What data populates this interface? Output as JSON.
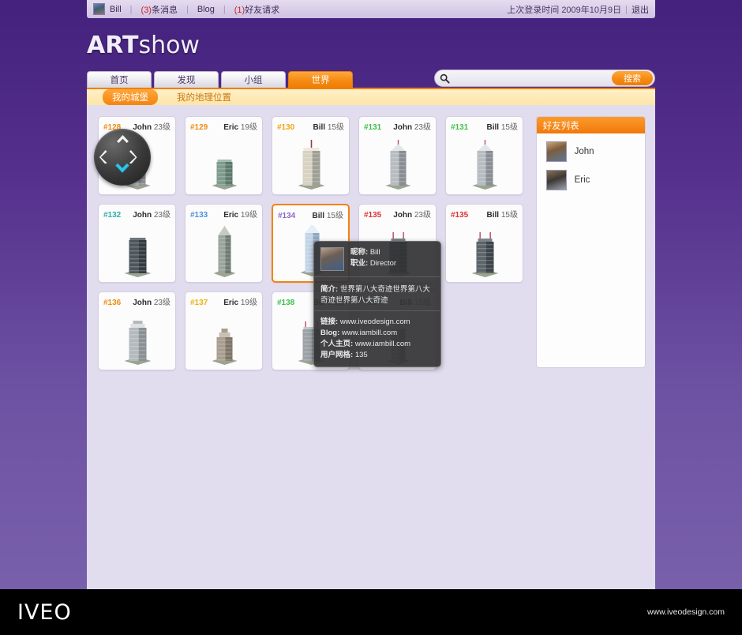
{
  "topbar": {
    "avatar_name": "user-avatar",
    "username": "Bill",
    "messages_count": "(3)",
    "messages_label": "条消息",
    "blog_label": "Blog",
    "requests_count": "(1)",
    "requests_label": "好友请求",
    "last_login_label": "上次登录时间",
    "last_login_date": "2009年10月9日",
    "logout_label": "退出",
    "separator": "|"
  },
  "logo": {
    "bold": "ART",
    "light": "show"
  },
  "nav": {
    "tabs": [
      {
        "label": "首页",
        "active": false
      },
      {
        "label": "发现",
        "active": false
      },
      {
        "label": "小组",
        "active": false
      },
      {
        "label": "世界",
        "active": true
      }
    ]
  },
  "search": {
    "value": "",
    "placeholder": "",
    "button_label": "搜索"
  },
  "subnav": {
    "tabs": [
      {
        "label": "我的城堡",
        "active": true
      },
      {
        "label": "我的地理位置",
        "active": false
      }
    ]
  },
  "dpad": {
    "up": "up-chevron",
    "down": "down-chevron",
    "left": "left-chevron",
    "right": "right-chevron",
    "active_direction": "down",
    "active_color": "#35c8f0"
  },
  "grid": {
    "level_suffix": "级",
    "cards": [
      {
        "id": "#128",
        "owner": "John",
        "level": "23",
        "id_color": "#f08c12",
        "building": "tower-silver-stepped",
        "selected": false
      },
      {
        "id": "#129",
        "owner": "Eric",
        "level": "19",
        "id_color": "#f08c12",
        "building": "tower-green-block",
        "selected": false
      },
      {
        "id": "#130",
        "owner": "Bill",
        "level": "15",
        "id_color": "#f0a512",
        "building": "tower-beige-spire",
        "selected": false
      },
      {
        "id": "#131",
        "owner": "John",
        "level": "23",
        "id_color": "#3fbf4a",
        "building": "tower-grey-crown",
        "selected": false
      },
      {
        "id": "#131",
        "owner": "Bill",
        "level": "15",
        "id_color": "#3fbf4a",
        "building": "tower-grey-crown",
        "selected": false
      },
      {
        "id": "#132",
        "owner": "John",
        "level": "23",
        "id_color": "#2ab0a8",
        "building": "tower-dark-slab",
        "selected": false
      },
      {
        "id": "#133",
        "owner": "Eric",
        "level": "19",
        "id_color": "#4f8fd8",
        "building": "tower-pointed-art-deco",
        "selected": false
      },
      {
        "id": "#134",
        "owner": "Bill",
        "level": "15",
        "id_color": "#8a68c8",
        "building": "tower-glass-blue",
        "selected": true
      },
      {
        "id": "#135",
        "owner": "John",
        "level": "23",
        "id_color": "#e03030",
        "building": "tower-dark-twin-antenna",
        "selected": false
      },
      {
        "id": "#135",
        "owner": "Bill",
        "level": "15",
        "id_color": "#e03030",
        "building": "tower-dark-twin-antenna",
        "selected": false
      },
      {
        "id": "#136",
        "owner": "John",
        "level": "23",
        "id_color": "#f08c12",
        "building": "tower-light-grey-block",
        "selected": false
      },
      {
        "id": "#137",
        "owner": "Eric",
        "level": "19",
        "id_color": "#f0b012",
        "building": "tower-stone-tiered",
        "selected": false
      },
      {
        "id": "#138",
        "owner": "Bill",
        "level": "15",
        "id_color": "#3fbf4a",
        "building": "tower-grey-twin",
        "selected": false
      },
      {
        "id": "#139",
        "owner": "Bill",
        "level": "15",
        "id_color": "#2ab0a8",
        "building": "tower-silver-tiered-spire",
        "selected": false
      }
    ]
  },
  "friends": {
    "title": "好友列表",
    "items": [
      {
        "name": "John",
        "avatar": "friend-avatar-john"
      },
      {
        "name": "Eric",
        "avatar": "friend-avatar-eric"
      }
    ]
  },
  "tooltip": {
    "avatar": "profile-avatar",
    "nickname_label": "昵称:",
    "nickname_value": "Bill",
    "job_label": "职业:",
    "job_value": "Director",
    "intro_label": "简介:",
    "intro_value": "世界第八大奇迹世界第八大奇迹世界第八大奇迹",
    "link_label": "链接:",
    "link_value": "www.iveodesign.com",
    "blog_label": "Blog:",
    "blog_value": "www.iambill.com",
    "homepage_label": "个人主页:",
    "homepage_value": "www.iambill.com",
    "grid_label": "用户网格:",
    "grid_value": "135"
  },
  "footer": {
    "logo": "IVEO",
    "site": "www.iveodesign.com"
  },
  "colors": {
    "accent_orange": "#f3830d",
    "bg_purple_dark": "#43217c",
    "bg_purple_light": "#7b63ad",
    "panel_bg": "#e1ddee"
  }
}
